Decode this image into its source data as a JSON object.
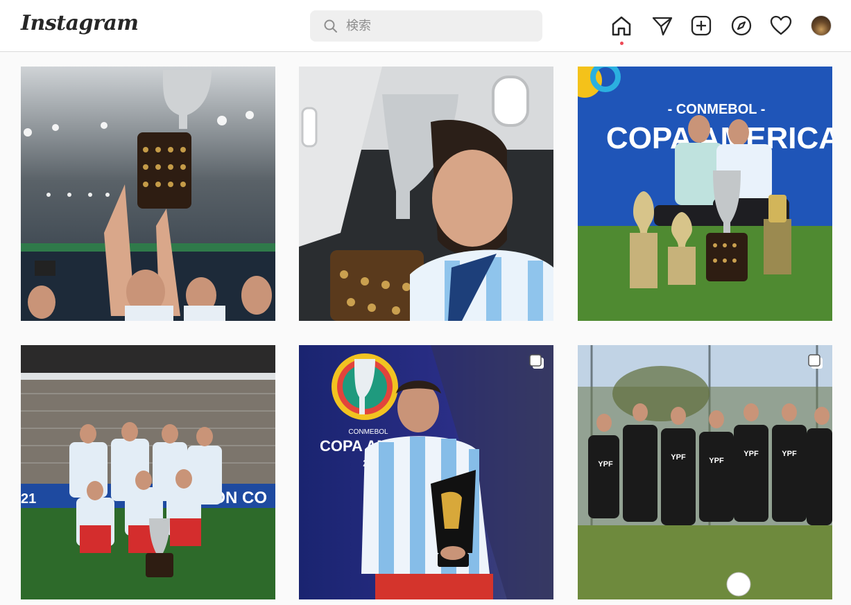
{
  "app": {
    "logo_text": "Instagram"
  },
  "search": {
    "placeholder": "検索",
    "value": ""
  },
  "nav": {
    "icons": [
      "home-icon",
      "direct-message-icon",
      "new-post-icon",
      "explore-icon",
      "activity-heart-icon"
    ],
    "active": "home-icon",
    "notification_dot_color": "#ed4956"
  },
  "grid": {
    "posts": [
      {
        "id": "post-1",
        "multiple": false
      },
      {
        "id": "post-2",
        "multiple": false
      },
      {
        "id": "post-3",
        "multiple": false,
        "banner_sub": "- CONMEBOL -",
        "banner_main": "COPA AMERICA"
      },
      {
        "id": "post-4",
        "multiple": false,
        "board_text": "PEÓN CO",
        "board_left": "21"
      },
      {
        "id": "post-5",
        "multiple": true,
        "board_small": "CONMEBOL",
        "board_main": "COPA AMER",
        "board_year": "21"
      },
      {
        "id": "post-6",
        "multiple": true,
        "shirt_text": "YPF"
      }
    ]
  },
  "colors": {
    "accent": "#ed4956",
    "border": "#dbdbdb",
    "text": "#262626"
  }
}
